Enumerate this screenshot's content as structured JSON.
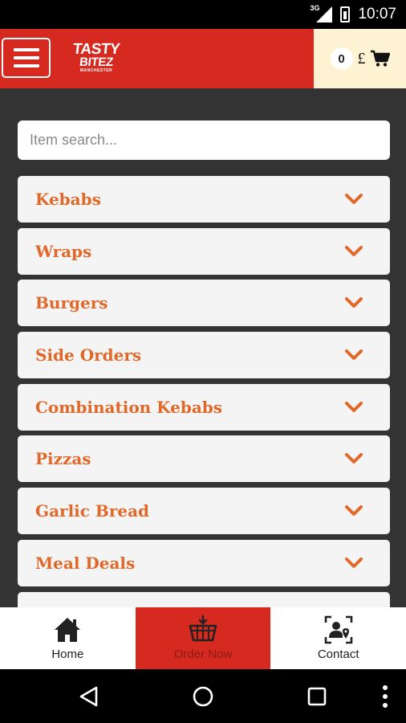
{
  "status_bar": {
    "time": "10:07",
    "network": "3G"
  },
  "header": {
    "logo": {
      "line1": "TASTY",
      "line2": "BITEZ",
      "line3": "MANCHESTER"
    },
    "cart_count": "0",
    "currency_symbol": "£",
    "icons": {
      "menu": "hamburger-menu-icon",
      "cart": "shopping-cart-icon"
    }
  },
  "search": {
    "placeholder": "Item search...",
    "value": ""
  },
  "categories": [
    {
      "label": "Kebabs"
    },
    {
      "label": "Wraps"
    },
    {
      "label": "Burgers"
    },
    {
      "label": "Side Orders"
    },
    {
      "label": "Combination Kebabs"
    },
    {
      "label": "Pizzas"
    },
    {
      "label": "Garlic Bread"
    },
    {
      "label": "Meal Deals"
    },
    {
      "label": ""
    }
  ],
  "bottom_nav": {
    "home": {
      "label": "Home",
      "icon": "home-icon"
    },
    "order_now": {
      "label": "Order Now",
      "icon": "basket-icon"
    },
    "contact": {
      "label": "Contact",
      "icon": "contact-card-icon"
    }
  },
  "colors": {
    "brand_red": "#d62a20",
    "category_orange": "#e0692a",
    "cart_background": "#fdf3d3",
    "content_background": "#333333"
  }
}
